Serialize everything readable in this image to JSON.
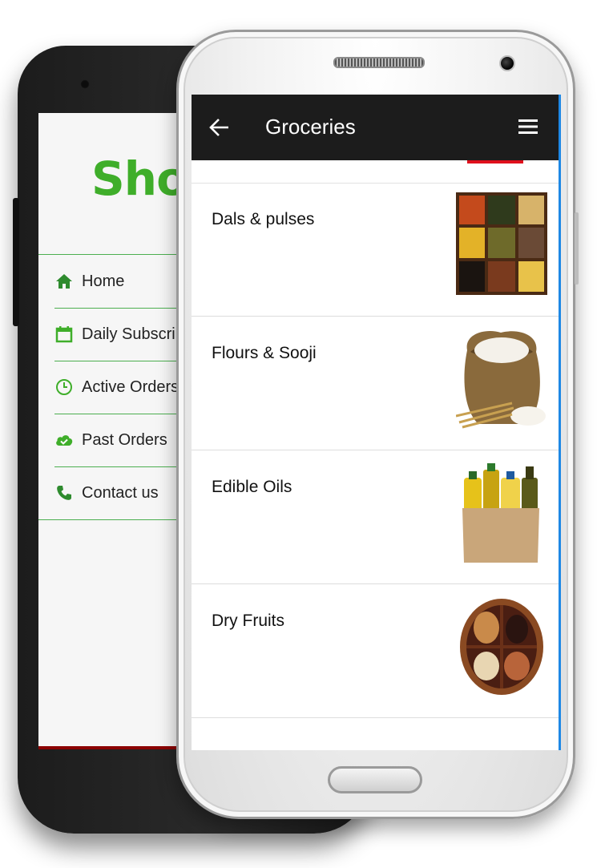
{
  "back_phone": {
    "logo_text": "Sho",
    "menu": [
      {
        "label": "Home",
        "icon": "home-icon"
      },
      {
        "label": "Daily Subscri",
        "icon": "calendar-icon"
      },
      {
        "label": "Active Orders",
        "icon": "clock-icon"
      },
      {
        "label": "Past Orders",
        "icon": "cloud-check-icon"
      },
      {
        "label": "Contact us",
        "icon": "phone-icon"
      }
    ],
    "accent_color": "#3fae2a"
  },
  "front_phone": {
    "appbar": {
      "title": "Groceries",
      "back_icon": "arrow-left-icon",
      "menu_icon": "hamburger-icon",
      "background": "#1c1c1c"
    },
    "categories": [
      {
        "name": "Dals & pulses",
        "image": "dals-pulses-image"
      },
      {
        "name": "Flours & Sooji",
        "image": "flour-sack-image"
      },
      {
        "name": "Edible Oils",
        "image": "oil-bottles-image"
      },
      {
        "name": "Dry Fruits",
        "image": "dry-fruits-bowl-image"
      }
    ]
  }
}
